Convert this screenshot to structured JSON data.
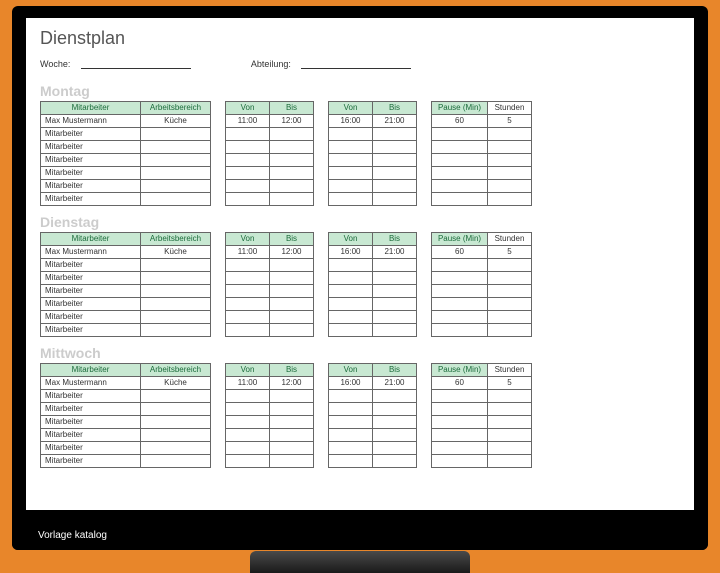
{
  "caption": "Vorlage katalog",
  "doc": {
    "title": "Dienstplan",
    "meta": {
      "week_label": "Woche:",
      "dept_label": "Abteilung:"
    },
    "headers": {
      "mitarbeiter": "Mitarbeiter",
      "arbeitsbereich": "Arbeitsbereich",
      "von": "Von",
      "bis": "Bis",
      "pause": "Pause (Min)",
      "stunden": "Stunden"
    },
    "placeholder_row": {
      "name": "Max Mustermann",
      "area": "Küche",
      "von1": "11:00",
      "bis1": "12:00",
      "von2": "16:00",
      "bis2": "21:00",
      "pause": "60",
      "stunden": "5"
    },
    "empty_name": "Mitarbeiter",
    "days": [
      {
        "label": "Montag"
      },
      {
        "label": "Dienstag"
      },
      {
        "label": "Mittwoch"
      }
    ]
  },
  "chart_data": {
    "type": "table",
    "title": "Dienstplan",
    "days": [
      "Montag",
      "Dienstag",
      "Mittwoch"
    ],
    "columns": [
      "Mitarbeiter",
      "Arbeitsbereich",
      "Von",
      "Bis",
      "Von",
      "Bis",
      "Pause (Min)",
      "Stunden"
    ],
    "rows_per_day": [
      {
        "Mitarbeiter": "Max Mustermann",
        "Arbeitsbereich": "Küche",
        "Von1": "11:00",
        "Bis1": "12:00",
        "Von2": "16:00",
        "Bis2": "21:00",
        "Pause (Min)": 60,
        "Stunden": 5
      },
      {
        "Mitarbeiter": "Mitarbeiter",
        "Arbeitsbereich": "",
        "Von1": "",
        "Bis1": "",
        "Von2": "",
        "Bis2": "",
        "Pause (Min)": "",
        "Stunden": ""
      },
      {
        "Mitarbeiter": "Mitarbeiter",
        "Arbeitsbereich": "",
        "Von1": "",
        "Bis1": "",
        "Von2": "",
        "Bis2": "",
        "Pause (Min)": "",
        "Stunden": ""
      },
      {
        "Mitarbeiter": "Mitarbeiter",
        "Arbeitsbereich": "",
        "Von1": "",
        "Bis1": "",
        "Von2": "",
        "Bis2": "",
        "Pause (Min)": "",
        "Stunden": ""
      },
      {
        "Mitarbeiter": "Mitarbeiter",
        "Arbeitsbereich": "",
        "Von1": "",
        "Bis1": "",
        "Von2": "",
        "Bis2": "",
        "Pause (Min)": "",
        "Stunden": ""
      },
      {
        "Mitarbeiter": "Mitarbeiter",
        "Arbeitsbereich": "",
        "Von1": "",
        "Bis1": "",
        "Von2": "",
        "Bis2": "",
        "Pause (Min)": "",
        "Stunden": ""
      },
      {
        "Mitarbeiter": "Mitarbeiter",
        "Arbeitsbereich": "",
        "Von1": "",
        "Bis1": "",
        "Von2": "",
        "Bis2": "",
        "Pause (Min)": "",
        "Stunden": ""
      }
    ]
  }
}
